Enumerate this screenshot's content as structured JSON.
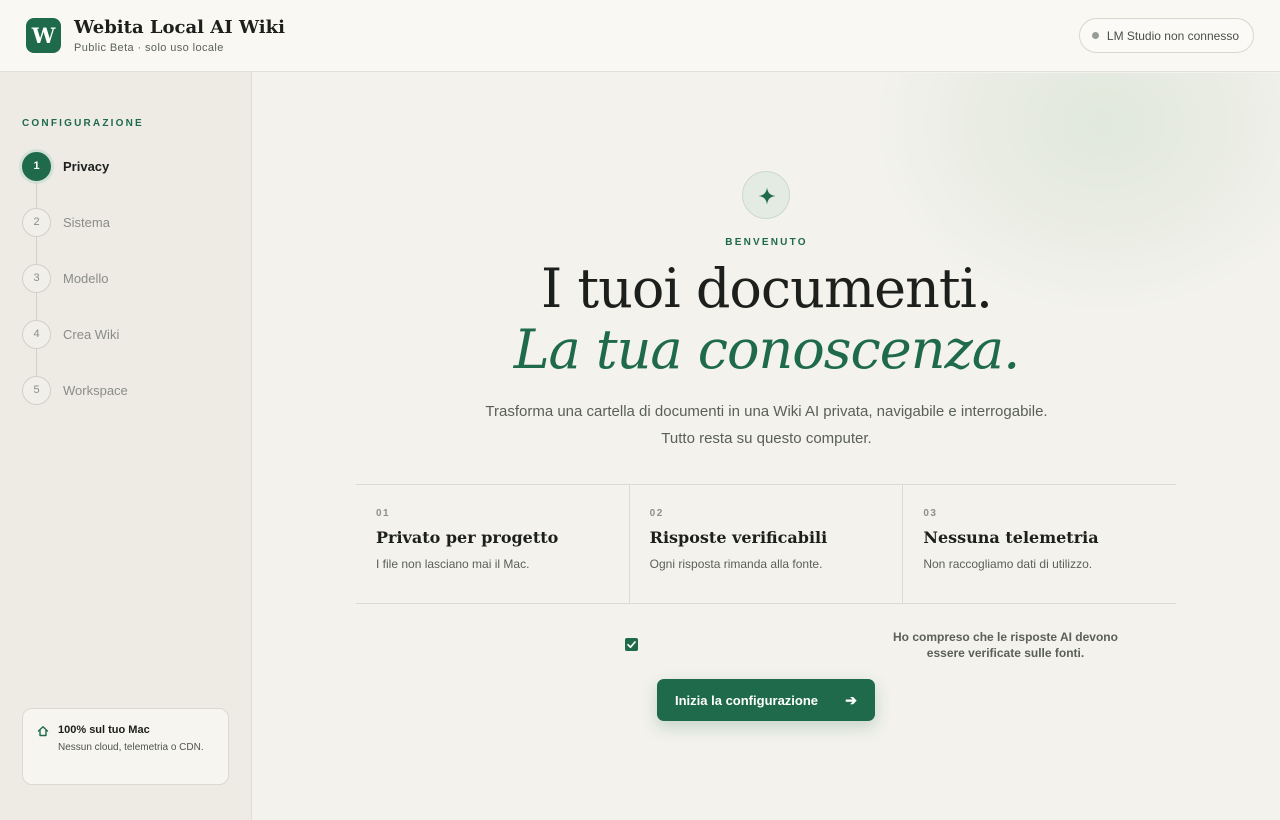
{
  "header": {
    "logo_letter": "W",
    "title": "Webita Local AI Wiki",
    "subtitle": "Public Beta · solo uso locale",
    "status_label": "LM Studio non connesso"
  },
  "sidebar": {
    "heading": "CONFIGURAZIONE",
    "steps": [
      {
        "number": "1",
        "label": "Privacy",
        "active": true
      },
      {
        "number": "2",
        "label": "Sistema"
      },
      {
        "number": "3",
        "label": "Modello"
      },
      {
        "number": "4",
        "label": "Crea Wiki"
      },
      {
        "number": "5",
        "label": "Workspace"
      }
    ],
    "info_card": {
      "icon": "home-icon",
      "title": "100% sul tuo Mac",
      "text": "Nessun cloud, telemetria o CDN."
    }
  },
  "main": {
    "badge_icon": "sparkle-icon",
    "eyebrow": "BENVENUTO",
    "headline_line1": "I tuoi documenti.",
    "headline_line2": "La tua conoscenza.",
    "lead_line1": "Trasforma una cartella di documenti in una Wiki AI privata, navigabile e interrogabile.",
    "lead_line2": "Tutto resta su questo computer.",
    "features": [
      {
        "number": "01",
        "title": "Privato per progetto",
        "description": "I file non lasciano mai il Mac."
      },
      {
        "number": "02",
        "title": "Risposte verificabili",
        "description": "Ogni risposta rimanda alla fonte."
      },
      {
        "number": "03",
        "title": "Nessuna telemetria",
        "description": "Non raccogliamo dati di utilizzo."
      }
    ],
    "consent_label": "Ho compreso che le risposte AI devono essere verificate sulle fonti.",
    "consent_checked": true,
    "cta_label": "Inizia la configurazione",
    "cta_arrow": "➔"
  },
  "colors": {
    "accent": "#1e6a4a",
    "background": "#f3f2ed",
    "sidebar": "#eeebe4"
  }
}
